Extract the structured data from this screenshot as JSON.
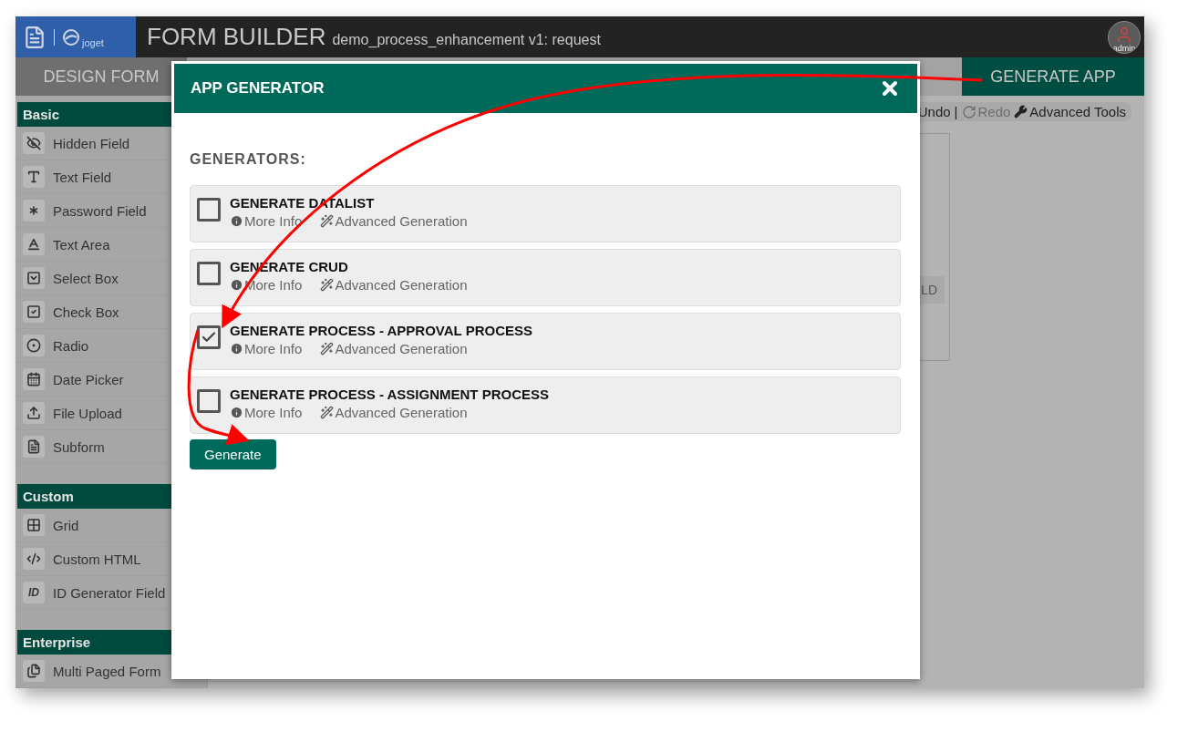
{
  "header": {
    "logo_text": "joget",
    "title": "FORM BUILDER",
    "subtitle": "demo_process_enhancement v1: request",
    "avatar_label": "admin"
  },
  "tabs": [
    {
      "label": "DESIGN FORM",
      "selected": false
    },
    {
      "label": "GENERATE APP",
      "selected": true
    }
  ],
  "palette": [
    {
      "title": "Basic",
      "items": [
        {
          "label": "Hidden Field",
          "kind": "hidden"
        },
        {
          "label": "Text Field",
          "kind": "text"
        },
        {
          "label": "Password Field",
          "kind": "password"
        },
        {
          "label": "Text Area",
          "kind": "textarea"
        },
        {
          "label": "Select Box",
          "kind": "select"
        },
        {
          "label": "Check Box",
          "kind": "checkbox"
        },
        {
          "label": "Radio",
          "kind": "radio"
        },
        {
          "label": "Date Picker",
          "kind": "date"
        },
        {
          "label": "File Upload",
          "kind": "upload"
        },
        {
          "label": "Subform",
          "kind": "subform"
        }
      ]
    },
    {
      "title": "Custom",
      "items": [
        {
          "label": "Grid",
          "kind": "grid"
        },
        {
          "label": "Custom HTML",
          "kind": "html"
        },
        {
          "label": "ID Generator Field",
          "kind": "badge",
          "badge": "ID"
        }
      ]
    },
    {
      "title": "Enterprise",
      "items": [
        {
          "label": "Multi Paged Form",
          "kind": "multipage"
        }
      ]
    }
  ],
  "toolbar": {
    "undo": "Undo",
    "separator": "|",
    "redo": "Redo",
    "redo_disabled": true,
    "advanced": "Advanced Tools"
  },
  "canvas": {
    "field_text": "LD"
  },
  "modal": {
    "title": "APP GENERATOR",
    "section_label": "GENERATORS:",
    "generators": [
      {
        "title": "GENERATE DATALIST",
        "checked": false,
        "more_info": "More Info",
        "advanced": "Advanced Generation"
      },
      {
        "title": "GENERATE CRUD",
        "checked": false,
        "more_info": "More Info",
        "advanced": "Advanced Generation"
      },
      {
        "title": "GENERATE PROCESS - APPROVAL PROCESS",
        "checked": true,
        "more_info": "More Info",
        "advanced": "Advanced Generation"
      },
      {
        "title": "GENERATE PROCESS - ASSIGNMENT PROCESS",
        "checked": false,
        "more_info": "More Info",
        "advanced": "Advanced Generation"
      }
    ],
    "button": "Generate"
  }
}
